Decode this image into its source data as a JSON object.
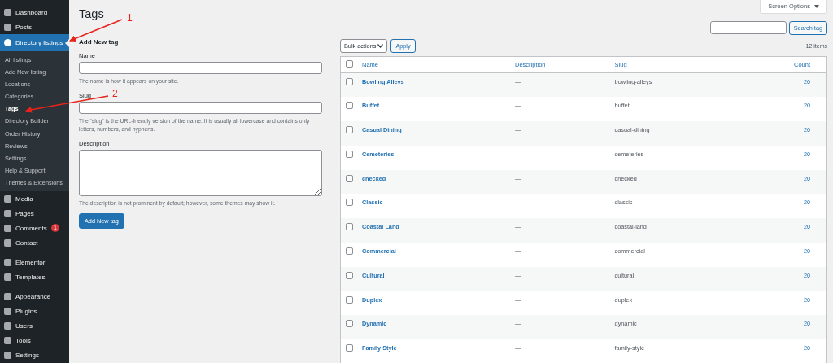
{
  "sidebar": {
    "groups": [
      [
        {
          "label": "Dashboard",
          "selected": false
        },
        {
          "label": "Posts",
          "selected": false
        },
        {
          "label": "Directory listings",
          "selected": true,
          "submenu": [
            {
              "label": "All listings",
              "selected": false
            },
            {
              "label": "Add New listing",
              "selected": false
            },
            {
              "label": "Locations",
              "selected": false
            },
            {
              "label": "Categories",
              "selected": false
            },
            {
              "label": "Tags",
              "selected": true
            },
            {
              "label": "Directory Builder",
              "selected": false
            },
            {
              "label": "Order History",
              "selected": false
            },
            {
              "label": "Reviews",
              "selected": false
            },
            {
              "label": "Settings",
              "selected": false
            },
            {
              "label": "Help & Support",
              "selected": false
            },
            {
              "label": "Themes & Extensions",
              "selected": false
            }
          ]
        },
        {
          "label": "Media",
          "selected": false
        },
        {
          "label": "Pages",
          "selected": false
        },
        {
          "label": "Comments",
          "selected": false,
          "badge": "1"
        },
        {
          "label": "Contact",
          "selected": false
        }
      ],
      [
        {
          "label": "Elementor",
          "selected": false
        },
        {
          "label": "Templates",
          "selected": false
        }
      ],
      [
        {
          "label": "Appearance",
          "selected": false
        },
        {
          "label": "Plugins",
          "selected": false
        },
        {
          "label": "Users",
          "selected": false
        },
        {
          "label": "Tools",
          "selected": false
        },
        {
          "label": "Settings",
          "selected": false
        }
      ]
    ]
  },
  "screen_options": "Screen Options",
  "page_title": "Tags",
  "form": {
    "heading": "Add New tag",
    "fields": [
      {
        "kind": "input",
        "label": "Name",
        "help": "The name is how it appears on your site."
      },
      {
        "kind": "input",
        "label": "Slug",
        "help": "The “slug” is the URL-friendly version of the name. It is usually all lowercase and contains only letters, numbers, and hyphens."
      },
      {
        "kind": "textarea",
        "label": "Description",
        "help": "The description is not prominent by default; however, some themes may show it."
      }
    ],
    "submit": "Add New tag"
  },
  "search": {
    "button": "Search tag"
  },
  "bulk_actions": "Bulk actions",
  "apply": "Apply",
  "items_count": "12 items",
  "table": {
    "select_all_checked": false,
    "columns": [
      "Name",
      "Description",
      "Slug",
      "Count"
    ],
    "rows": [
      {
        "name": "Bowling Alleys",
        "description": "—",
        "slug": "bowling-alleys",
        "count": "20",
        "checked": false
      },
      {
        "name": "Buffet",
        "description": "—",
        "slug": "buffet",
        "count": "20",
        "checked": false
      },
      {
        "name": "Casual Dining",
        "description": "—",
        "slug": "casual-dining",
        "count": "20",
        "checked": false
      },
      {
        "name": "Cemeteries",
        "description": "—",
        "slug": "cemeteries",
        "count": "20",
        "checked": false
      },
      {
        "name": "checked",
        "description": "—",
        "slug": "checked",
        "count": "20",
        "checked": false
      },
      {
        "name": "Classic",
        "description": "—",
        "slug": "classic",
        "count": "20",
        "checked": false
      },
      {
        "name": "Coastal Land",
        "description": "—",
        "slug": "coastal-land",
        "count": "20",
        "checked": false
      },
      {
        "name": "Commercial",
        "description": "—",
        "slug": "commercial",
        "count": "20",
        "checked": false
      },
      {
        "name": "Cultural",
        "description": "—",
        "slug": "cultural",
        "count": "20",
        "checked": false
      },
      {
        "name": "Duplex",
        "description": "—",
        "slug": "duplex",
        "count": "20",
        "checked": false
      },
      {
        "name": "Dynamic",
        "description": "—",
        "slug": "dynamic",
        "count": "20",
        "checked": false
      },
      {
        "name": "Family Style",
        "description": "—",
        "slug": "family-style",
        "count": "20",
        "checked": false
      }
    ]
  },
  "annotations": [
    {
      "label": "1"
    },
    {
      "label": "2"
    }
  ]
}
